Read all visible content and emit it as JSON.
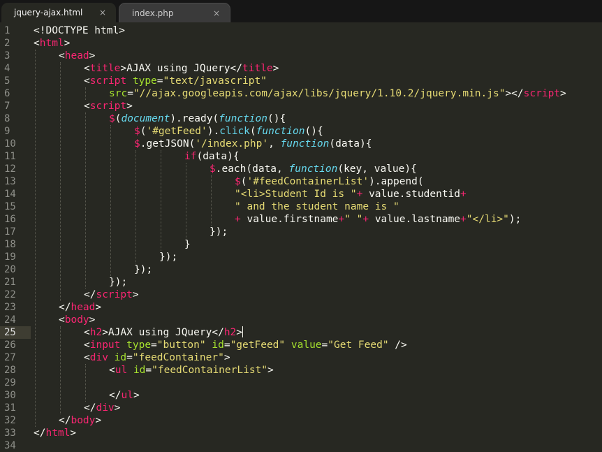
{
  "tabs": [
    {
      "label": "jquery-ajax.html",
      "active": true
    },
    {
      "label": "index.php",
      "active": false
    }
  ],
  "close_glyph": "×",
  "current_line": 25,
  "theme": {
    "background": "#272822",
    "tag": "#f92672",
    "attribute": "#a6e22e",
    "string": "#e6db74",
    "keyword_italic": "#66d9ef",
    "text": "#f8f8f2"
  },
  "lines": [
    {
      "n": "1",
      "i": 0,
      "tokens": [
        [
          "p",
          "<!DOCTYPE html>"
        ]
      ]
    },
    {
      "n": "2",
      "i": 0,
      "tokens": [
        [
          "p",
          "<"
        ],
        [
          "t",
          "html"
        ],
        [
          "p",
          ">"
        ]
      ]
    },
    {
      "n": "3",
      "i": 1,
      "tokens": [
        [
          "p",
          "<"
        ],
        [
          "t",
          "head"
        ],
        [
          "p",
          ">"
        ]
      ]
    },
    {
      "n": "4",
      "i": 2,
      "tokens": [
        [
          "p",
          "<"
        ],
        [
          "t",
          "title"
        ],
        [
          "p",
          ">AJAX using JQuery</"
        ],
        [
          "t",
          "title"
        ],
        [
          "p",
          ">"
        ]
      ]
    },
    {
      "n": "5",
      "i": 2,
      "tokens": [
        [
          "p",
          "<"
        ],
        [
          "t",
          "script"
        ],
        [
          "p",
          " "
        ],
        [
          "a",
          "type"
        ],
        [
          "p",
          "="
        ],
        [
          "s",
          "\"text/javascript\""
        ]
      ]
    },
    {
      "n": "6",
      "i": 3,
      "tokens": [
        [
          "a",
          "src"
        ],
        [
          "p",
          "="
        ],
        [
          "s",
          "\"//ajax.googleapis.com/ajax/libs/jquery/1.10.2/jquery.min.js\""
        ],
        [
          "p",
          "></"
        ],
        [
          "t",
          "script"
        ],
        [
          "p",
          ">"
        ]
      ]
    },
    {
      "n": "7",
      "i": 2,
      "tokens": [
        [
          "p",
          "<"
        ],
        [
          "t",
          "script"
        ],
        [
          "p",
          ">"
        ]
      ]
    },
    {
      "n": "8",
      "i": 3,
      "tokens": [
        [
          "o",
          "$"
        ],
        [
          "p",
          "("
        ],
        [
          "f",
          "document"
        ],
        [
          "p",
          ").ready("
        ],
        [
          "f",
          "function"
        ],
        [
          "p",
          "(){"
        ]
      ]
    },
    {
      "n": "9",
      "i": 4,
      "tokens": [
        [
          "o",
          "$"
        ],
        [
          "p",
          "("
        ],
        [
          "s",
          "'#getFeed'"
        ],
        [
          "p",
          ")."
        ],
        [
          "b",
          "click"
        ],
        [
          "p",
          "("
        ],
        [
          "f",
          "function"
        ],
        [
          "p",
          "(){"
        ]
      ]
    },
    {
      "n": "10",
      "i": 4,
      "tokens": [
        [
          "o",
          "$"
        ],
        [
          "p",
          ".getJSON("
        ],
        [
          "s",
          "'/index.php'"
        ],
        [
          "p",
          ", "
        ],
        [
          "f",
          "function"
        ],
        [
          "p",
          "(data){"
        ]
      ]
    },
    {
      "n": "11",
      "i": 6,
      "tokens": [
        [
          "k",
          "if"
        ],
        [
          "p",
          "(data){"
        ]
      ]
    },
    {
      "n": "12",
      "i": 7,
      "tokens": [
        [
          "o",
          "$"
        ],
        [
          "p",
          ".each(data, "
        ],
        [
          "f",
          "function"
        ],
        [
          "p",
          "(key, value){"
        ]
      ]
    },
    {
      "n": "13",
      "i": 8,
      "tokens": [
        [
          "o",
          "$"
        ],
        [
          "p",
          "("
        ],
        [
          "s",
          "'#feedContainerList'"
        ],
        [
          "p",
          ").append("
        ]
      ]
    },
    {
      "n": "14",
      "i": 8,
      "tokens": [
        [
          "s",
          "\"<li>Student Id is \""
        ],
        [
          "o",
          "+"
        ],
        [
          "p",
          " value.studentid"
        ],
        [
          "o",
          "+"
        ]
      ]
    },
    {
      "n": "15",
      "i": 8,
      "tokens": [
        [
          "s",
          "\" and the student name is \""
        ]
      ]
    },
    {
      "n": "16",
      "i": 8,
      "tokens": [
        [
          "o",
          "+"
        ],
        [
          "p",
          " value.firstname"
        ],
        [
          "o",
          "+"
        ],
        [
          "s",
          "\" \""
        ],
        [
          "o",
          "+"
        ],
        [
          "p",
          " value.lastname"
        ],
        [
          "o",
          "+"
        ],
        [
          "s",
          "\"</li>\""
        ],
        [
          "p",
          ");"
        ]
      ]
    },
    {
      "n": "17",
      "i": 7,
      "tokens": [
        [
          "p",
          "});"
        ]
      ]
    },
    {
      "n": "18",
      "i": 6,
      "tokens": [
        [
          "p",
          "}"
        ]
      ]
    },
    {
      "n": "19",
      "i": 5,
      "tokens": [
        [
          "p",
          "});"
        ]
      ]
    },
    {
      "n": "20",
      "i": 4,
      "tokens": [
        [
          "p",
          "});"
        ]
      ]
    },
    {
      "n": "21",
      "i": 3,
      "tokens": [
        [
          "p",
          "});"
        ]
      ]
    },
    {
      "n": "22",
      "i": 2,
      "tokens": [
        [
          "p",
          "</"
        ],
        [
          "t",
          "script"
        ],
        [
          "p",
          ">"
        ]
      ]
    },
    {
      "n": "23",
      "i": 1,
      "tokens": [
        [
          "p",
          "</"
        ],
        [
          "t",
          "head"
        ],
        [
          "p",
          ">"
        ]
      ]
    },
    {
      "n": "24",
      "i": 1,
      "tokens": [
        [
          "p",
          "<"
        ],
        [
          "t",
          "body"
        ],
        [
          "p",
          ">"
        ]
      ]
    },
    {
      "n": "25",
      "i": 2,
      "tokens": [
        [
          "p",
          "<"
        ],
        [
          "t",
          "h2"
        ],
        [
          "p",
          ">AJAX using JQuery</"
        ],
        [
          "t",
          "h2"
        ],
        [
          "p",
          ">"
        ]
      ],
      "cursor": true
    },
    {
      "n": "26",
      "i": 2,
      "tokens": [
        [
          "p",
          "<"
        ],
        [
          "t",
          "input"
        ],
        [
          "p",
          " "
        ],
        [
          "a",
          "type"
        ],
        [
          "p",
          "="
        ],
        [
          "s",
          "\"button\""
        ],
        [
          "p",
          " "
        ],
        [
          "a",
          "id"
        ],
        [
          "p",
          "="
        ],
        [
          "s",
          "\"getFeed\""
        ],
        [
          "p",
          " "
        ],
        [
          "a",
          "value"
        ],
        [
          "p",
          "="
        ],
        [
          "s",
          "\"Get Feed\""
        ],
        [
          "p",
          " />"
        ]
      ]
    },
    {
      "n": "27",
      "i": 2,
      "tokens": [
        [
          "p",
          "<"
        ],
        [
          "t",
          "div"
        ],
        [
          "p",
          " "
        ],
        [
          "a",
          "id"
        ],
        [
          "p",
          "="
        ],
        [
          "s",
          "\"feedContainer\""
        ],
        [
          "p",
          ">"
        ]
      ]
    },
    {
      "n": "28",
      "i": 3,
      "tokens": [
        [
          "p",
          "<"
        ],
        [
          "t",
          "ul"
        ],
        [
          "p",
          " "
        ],
        [
          "a",
          "id"
        ],
        [
          "p",
          "="
        ],
        [
          "s",
          "\"feedContainerList\""
        ],
        [
          "p",
          ">"
        ]
      ]
    },
    {
      "n": "29",
      "i": 0,
      "tokens": []
    },
    {
      "n": "30",
      "i": 3,
      "tokens": [
        [
          "p",
          "</"
        ],
        [
          "t",
          "ul"
        ],
        [
          "p",
          ">"
        ]
      ]
    },
    {
      "n": "31",
      "i": 2,
      "tokens": [
        [
          "p",
          "</"
        ],
        [
          "t",
          "div"
        ],
        [
          "p",
          ">"
        ]
      ]
    },
    {
      "n": "32",
      "i": 1,
      "tokens": [
        [
          "p",
          "</"
        ],
        [
          "t",
          "body"
        ],
        [
          "p",
          ">"
        ]
      ]
    },
    {
      "n": "33",
      "i": 0,
      "tokens": [
        [
          "p",
          "</"
        ],
        [
          "t",
          "html"
        ],
        [
          "p",
          ">"
        ]
      ]
    },
    {
      "n": "34",
      "i": 0,
      "tokens": []
    }
  ]
}
